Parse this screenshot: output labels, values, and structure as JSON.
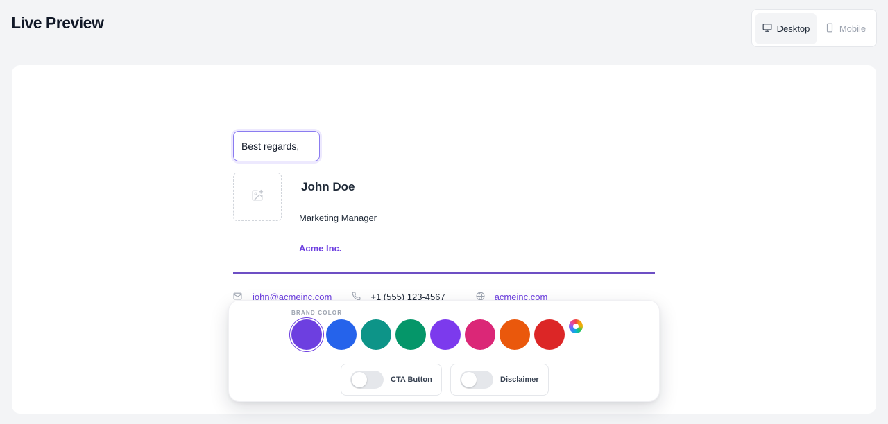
{
  "header": {
    "title": "Live Preview"
  },
  "view_toggle": {
    "desktop_label": "Desktop",
    "mobile_label": "Mobile",
    "selected": "Desktop"
  },
  "signature": {
    "greeting": "Best regards,",
    "name": "John Doe",
    "job_title": "Marketing Manager",
    "company": "Acme Inc.",
    "email": "john@acmeinc.com",
    "phone": "+1 (555) 123-4567",
    "website": "acmeinc.com"
  },
  "toolbar": {
    "brand_color_label": "BRAND COLOR",
    "swatches": [
      "#6d3fe0",
      "#2563eb",
      "#0d9488",
      "#059669",
      "#7c3aed",
      "#db2777",
      "#ea580c",
      "#dc2626"
    ],
    "selected_color": "#6d3fe0",
    "cta_label": "CTA Button",
    "cta_enabled": false,
    "disclaimer_label": "Disclaimer",
    "disclaimer_enabled": false
  },
  "icons": [
    "monitor-icon",
    "smartphone-icon",
    "image-plus-icon",
    "mail-icon",
    "phone-icon",
    "globe-icon",
    "color-wheel-icon"
  ]
}
